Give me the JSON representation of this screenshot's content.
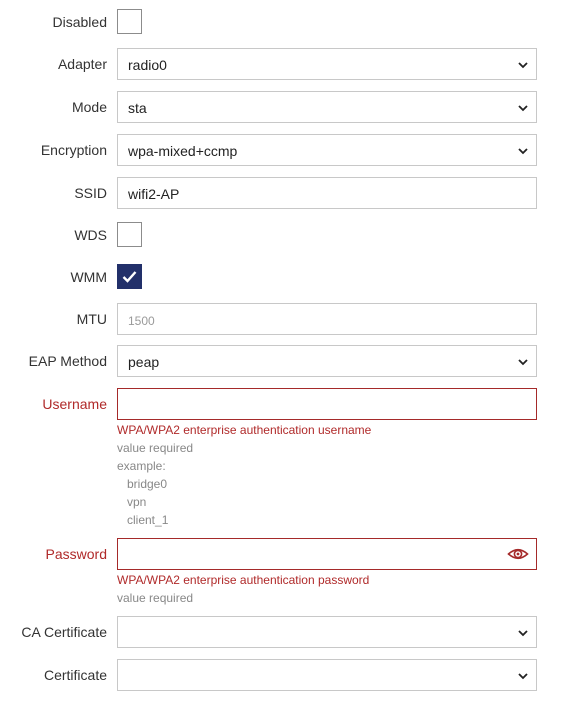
{
  "fields": {
    "disabled": {
      "label": "Disabled",
      "checked": false
    },
    "adapter": {
      "label": "Adapter",
      "value": "radio0"
    },
    "mode": {
      "label": "Mode",
      "value": "sta"
    },
    "encryption": {
      "label": "Encryption",
      "value": "wpa-mixed+ccmp"
    },
    "ssid": {
      "label": "SSID",
      "value": "wifi2-AP"
    },
    "wds": {
      "label": "WDS",
      "checked": false
    },
    "wmm": {
      "label": "WMM",
      "checked": true
    },
    "mtu": {
      "label": "MTU",
      "placeholder": "1500"
    },
    "eap_method": {
      "label": "EAP Method",
      "value": "peap"
    },
    "username": {
      "label": "Username",
      "value": "",
      "description": "WPA/WPA2 enterprise authentication username",
      "required": "value required",
      "example_label": "example:",
      "examples": [
        "bridge0",
        "vpn",
        "client_1"
      ]
    },
    "password": {
      "label": "Password",
      "value": "",
      "description": "WPA/WPA2 enterprise authentication password",
      "required": "value required"
    },
    "ca_certificate": {
      "label": "CA Certificate",
      "value": ""
    },
    "certificate": {
      "label": "Certificate",
      "value": ""
    }
  },
  "icons": {
    "select_arrow": "chevron-down-icon",
    "password_toggle": "eye-icon",
    "checkmark": "checkmark-icon"
  },
  "colors": {
    "checkbox_checked": "#22306a",
    "error": "#b02a2a",
    "error_border": "#a52a2a"
  }
}
